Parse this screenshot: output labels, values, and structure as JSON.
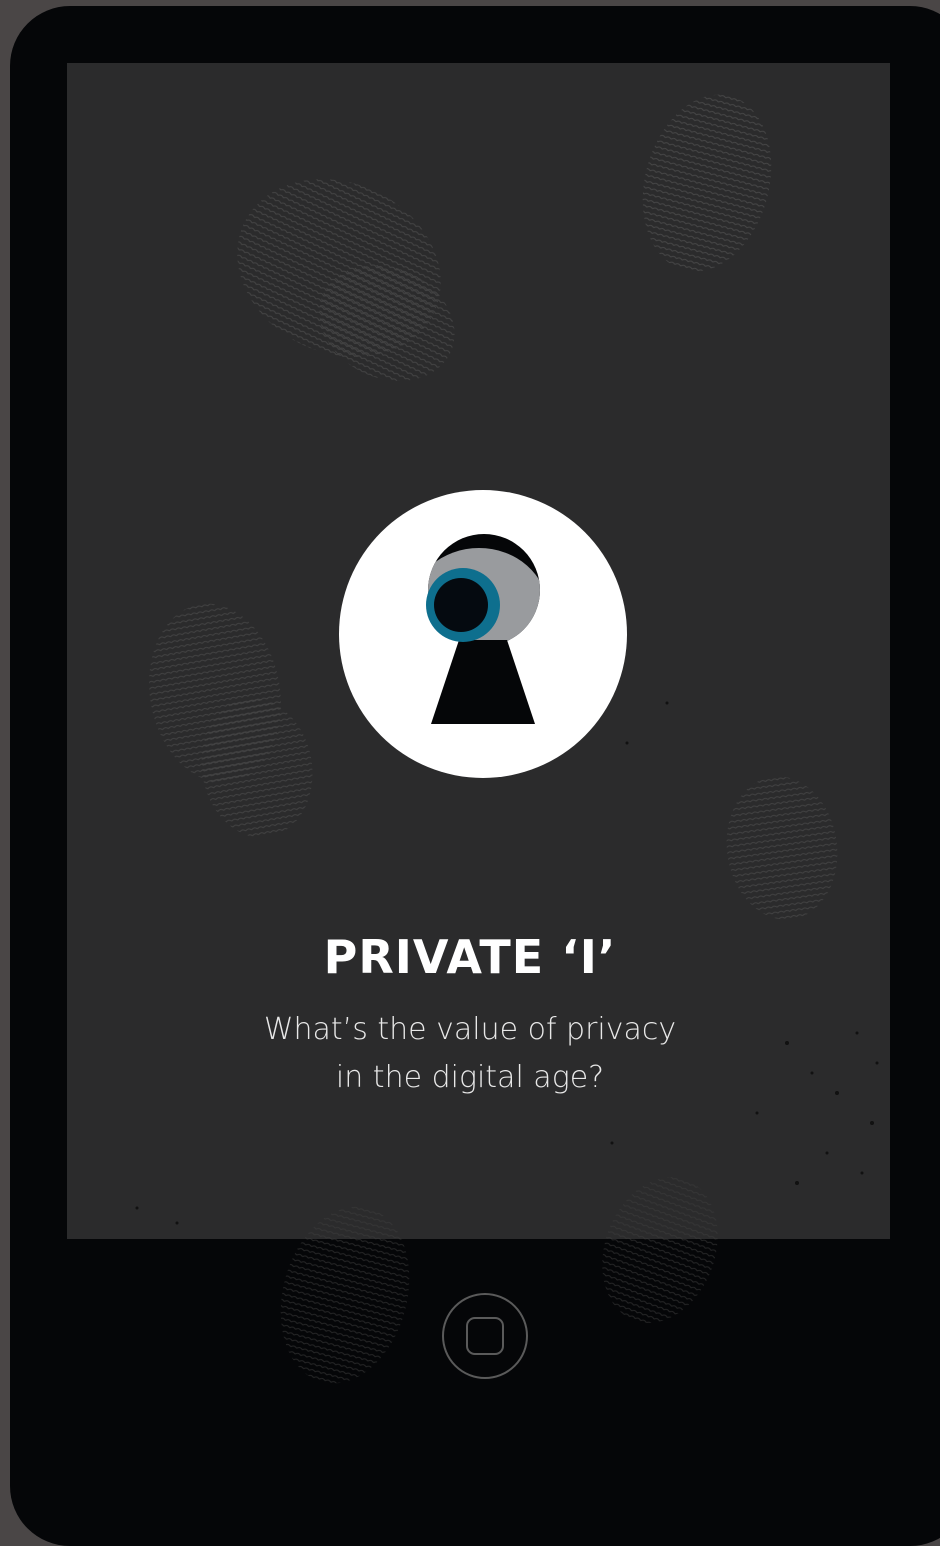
{
  "app": {
    "title": "PRIVATE ‘I’",
    "subtitle_lines": [
      "What’s the value of privacy",
      "in the digital age?"
    ]
  },
  "logo": {
    "icon": "keyhole-eye-icon",
    "colors": {
      "circle": "#ffffff",
      "keyhole": "#050608",
      "eye_white": "#999b9e",
      "iris": "#0e6f8e",
      "pupil": "#050a10"
    }
  },
  "device": {
    "home_button_icon": "home-button-icon"
  },
  "theme": {
    "frame": "#050608",
    "screen": "#2b2b2c",
    "text": "#ffffff"
  }
}
